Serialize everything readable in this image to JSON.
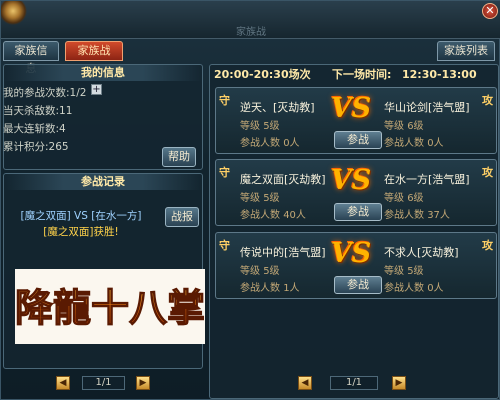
{
  "window": {
    "title": "家族战",
    "close_label": "✕"
  },
  "tabs": {
    "family_info": "家族信息",
    "family_war": "家族战",
    "family_list": "家族列表"
  },
  "my_info": {
    "header": "我的信息",
    "join_count_label": "我的参战次数",
    "join_count_value": "1/2",
    "kills_label": "当天杀敌数",
    "kills_value": "11",
    "streak_label": "最大连斩数",
    "streak_value": "4",
    "points_label": "累计积分",
    "points_value": "265",
    "help_label": "帮助",
    "plus_label": "+"
  },
  "battle_record": {
    "header": "参战记录",
    "line1": "[魔之双面] VS [在水一方]",
    "line2": "[魔之双面]获胜!",
    "report_label": "战报",
    "banner_text": "降龍十八掌",
    "page": "1/1"
  },
  "schedule": {
    "current_round": "20:00-20:30场次",
    "next_label": "下一场时间:",
    "next_time": "12:30-13:00",
    "defend_label": "守",
    "attack_label": "攻",
    "vs_label": "VS",
    "join_label": "参战",
    "level_label": "等级",
    "members_label": "参战人数",
    "page": "1/1",
    "matches": [
      {
        "defender": "逆天、[灭劫教]",
        "defender_level": "5级",
        "defender_members": "0人",
        "attacker": "华山论剑[浩气盟]",
        "attacker_level": "6级",
        "attacker_members": "0人"
      },
      {
        "defender": "魔之双面[灭劫教]",
        "defender_level": "5级",
        "defender_members": "40人",
        "attacker": "在水一方[浩气盟]",
        "attacker_level": "6级",
        "attacker_members": "37人"
      },
      {
        "defender": "传说中的[浩气盟]",
        "defender_level": "5级",
        "defender_members": "1人",
        "attacker": "不求人[灭劫教]",
        "attacker_level": "5级",
        "attacker_members": "0人"
      }
    ]
  },
  "colors": {
    "accent": "#ffe9a8",
    "active_tab": "#d24a2b",
    "vs": "#ffb300"
  }
}
